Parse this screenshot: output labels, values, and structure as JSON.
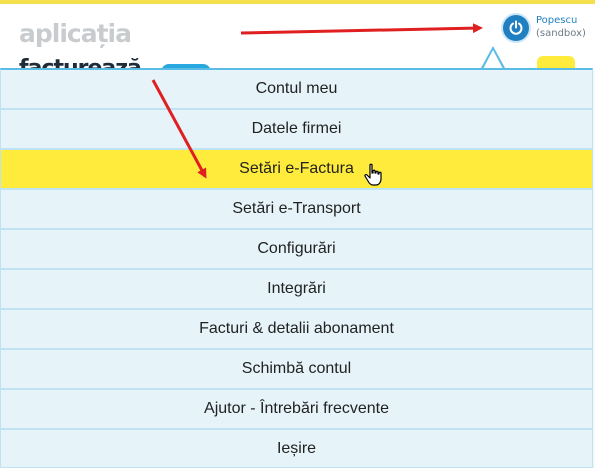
{
  "header": {
    "logo_text": "aplicația",
    "brand_text": "facturează"
  },
  "user": {
    "name": "Popescu",
    "env": "(sandbox)",
    "icon": "power-icon"
  },
  "menu": {
    "items": [
      {
        "label": "Contul meu"
      },
      {
        "label": "Datele firmei"
      },
      {
        "label": "Setări e-Factura"
      },
      {
        "label": "Setări e-Transport"
      },
      {
        "label": "Configurări"
      },
      {
        "label": "Integrări"
      },
      {
        "label": "Facturi & detalii abonament"
      },
      {
        "label": "Schimbă contul"
      },
      {
        "label": "Ajutor - Întrebări frecvente"
      },
      {
        "label": "Ieșire"
      }
    ],
    "active_index": 2
  },
  "colors": {
    "accent_blue": "#1f7fc0",
    "highlight_yellow": "#ffeb3b",
    "menu_bg": "#e6f4fa",
    "arrow_red": "#e02020"
  }
}
